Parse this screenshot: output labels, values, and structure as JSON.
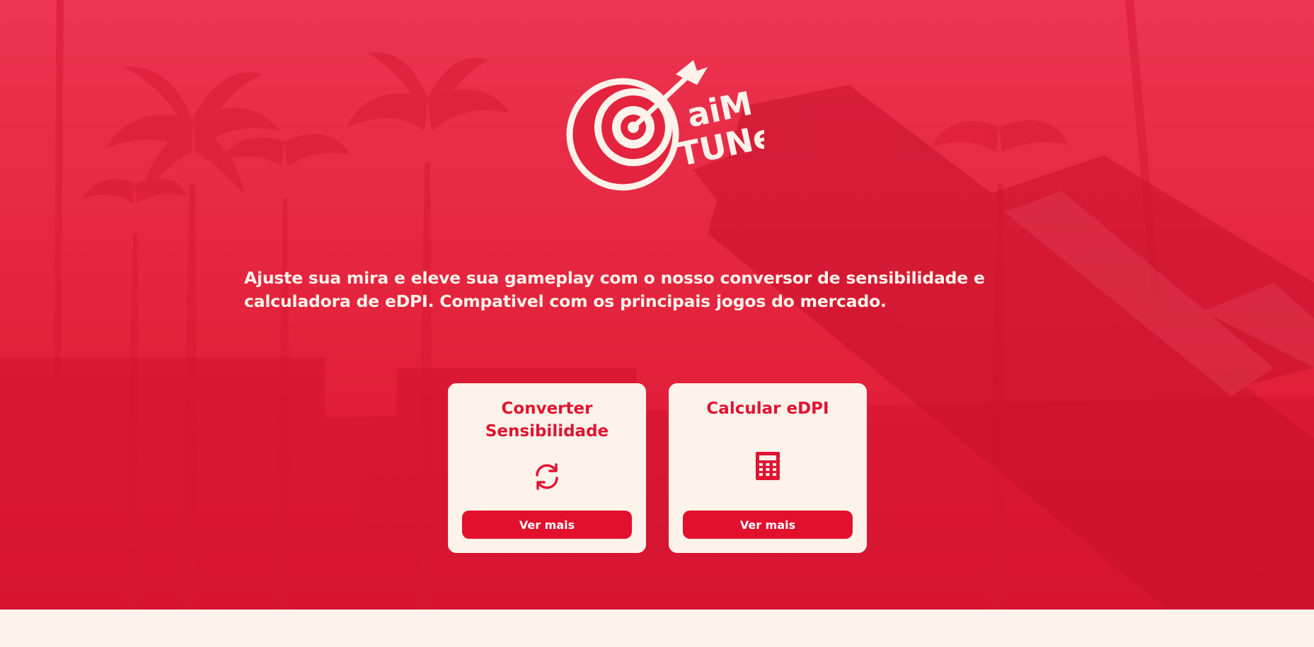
{
  "brand": {
    "logo_text": "aim TUNe",
    "colors": {
      "primary": "#e3102d",
      "cream": "#fdf3ea"
    }
  },
  "hero": {
    "tagline": "Ajuste sua mira e eleve sua gameplay com o nosso conversor de sensibilidade e calculadora de eDPI. Compativel com os principais jogos do mercado."
  },
  "cards": [
    {
      "title": "Converter Sensibilidade",
      "icon": "refresh-icon",
      "button_label": "Ver mais"
    },
    {
      "title": "Calcular eDPI",
      "icon": "calculator-icon",
      "button_label": "Ver mais"
    }
  ]
}
